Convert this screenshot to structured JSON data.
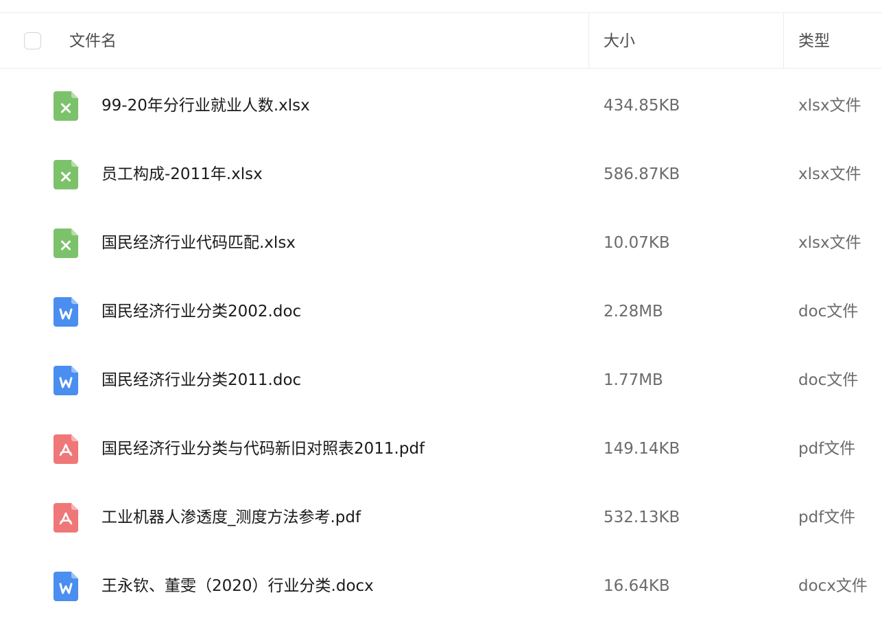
{
  "header": {
    "name_label": "文件名",
    "size_label": "大小",
    "type_label": "类型"
  },
  "colors": {
    "xlsx": "#7cc26a",
    "doc": "#4a8ef0",
    "pdf": "#f07778"
  },
  "files": [
    {
      "icon": "xlsx-file-icon",
      "kind": "xlsx",
      "name": "99-20年分行业就业人数.xlsx",
      "size": "434.85KB",
      "type": "xlsx文件"
    },
    {
      "icon": "xlsx-file-icon",
      "kind": "xlsx",
      "name": "员工构成-2011年.xlsx",
      "size": "586.87KB",
      "type": "xlsx文件"
    },
    {
      "icon": "xlsx-file-icon",
      "kind": "xlsx",
      "name": "国民经济行业代码匹配.xlsx",
      "size": "10.07KB",
      "type": "xlsx文件"
    },
    {
      "icon": "word-file-icon",
      "kind": "doc",
      "name": "国民经济行业分类2002.doc",
      "size": "2.28MB",
      "type": "doc文件"
    },
    {
      "icon": "word-file-icon",
      "kind": "doc",
      "name": "国民经济行业分类2011.doc",
      "size": "1.77MB",
      "type": "doc文件"
    },
    {
      "icon": "pdf-file-icon",
      "kind": "pdf",
      "name": "国民经济行业分类与代码新旧对照表2011.pdf",
      "size": "149.14KB",
      "type": "pdf文件"
    },
    {
      "icon": "pdf-file-icon",
      "kind": "pdf",
      "name": "工业机器人渗透度_测度方法参考.pdf",
      "size": "532.13KB",
      "type": "pdf文件"
    },
    {
      "icon": "word-file-icon",
      "kind": "doc",
      "name": "王永钦、董雯（2020）行业分类.docx",
      "size": "16.64KB",
      "type": "docx文件"
    }
  ]
}
